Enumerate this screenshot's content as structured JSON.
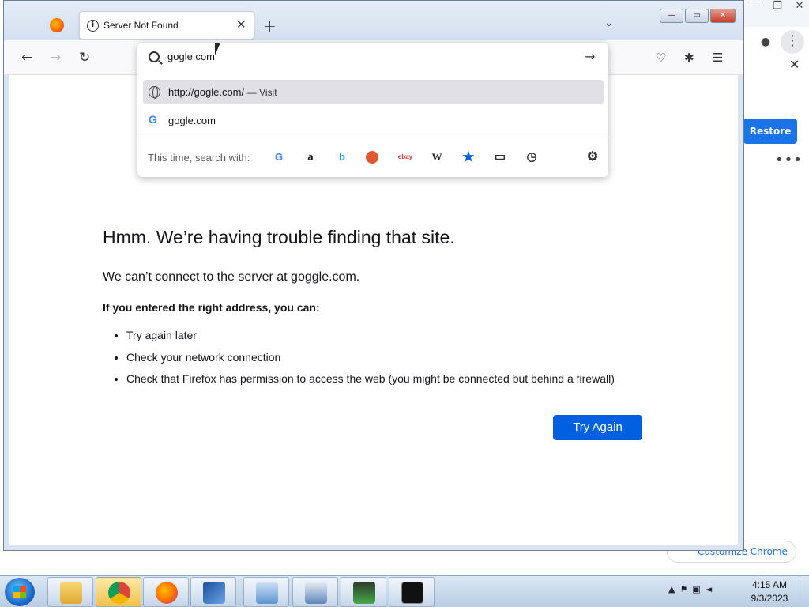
{
  "chrome_bg": {
    "restore_label": "Restore",
    "customize_label": "Customize Chrome",
    "accent": "#1a73e8"
  },
  "firefox": {
    "tab": {
      "title": "Server Not Found",
      "icon": "info-icon"
    },
    "window_buttons": [
      "minimize",
      "maximize",
      "close"
    ],
    "urlbar": {
      "value": "gogle.com",
      "suggestions": [
        {
          "icon": "globe-icon",
          "text": "http://gogle.com/",
          "action": "— Visit",
          "selected": true
        },
        {
          "icon": "google-icon",
          "text": "gogle.com",
          "action": "",
          "selected": false
        }
      ],
      "search_with_label": "This time, search with:",
      "engines": [
        "google",
        "amazon",
        "bing",
        "duckduckgo",
        "ebay",
        "wikipedia",
        "bookmarks",
        "tabs",
        "history"
      ]
    },
    "error": {
      "title": "Hmm. We’re having trouble finding that site.",
      "subtitle": "We can’t connect to the server at goggle.com.",
      "hint": "If you entered the right address, you can:",
      "items": [
        "Try again later",
        "Check your network connection",
        "Check that Firefox has permission to access the web (you might be connected but behind a firewall)"
      ],
      "button": "Try Again",
      "accent": "#0060df"
    }
  },
  "taskbar": {
    "apps": [
      "file-explorer",
      "chrome",
      "firefox",
      "virtualbox",
      "control-panel",
      "remote-desktop",
      "task-manager",
      "command-prompt"
    ],
    "clock_time": "4:15 AM",
    "clock_date": "9/3/2023"
  }
}
